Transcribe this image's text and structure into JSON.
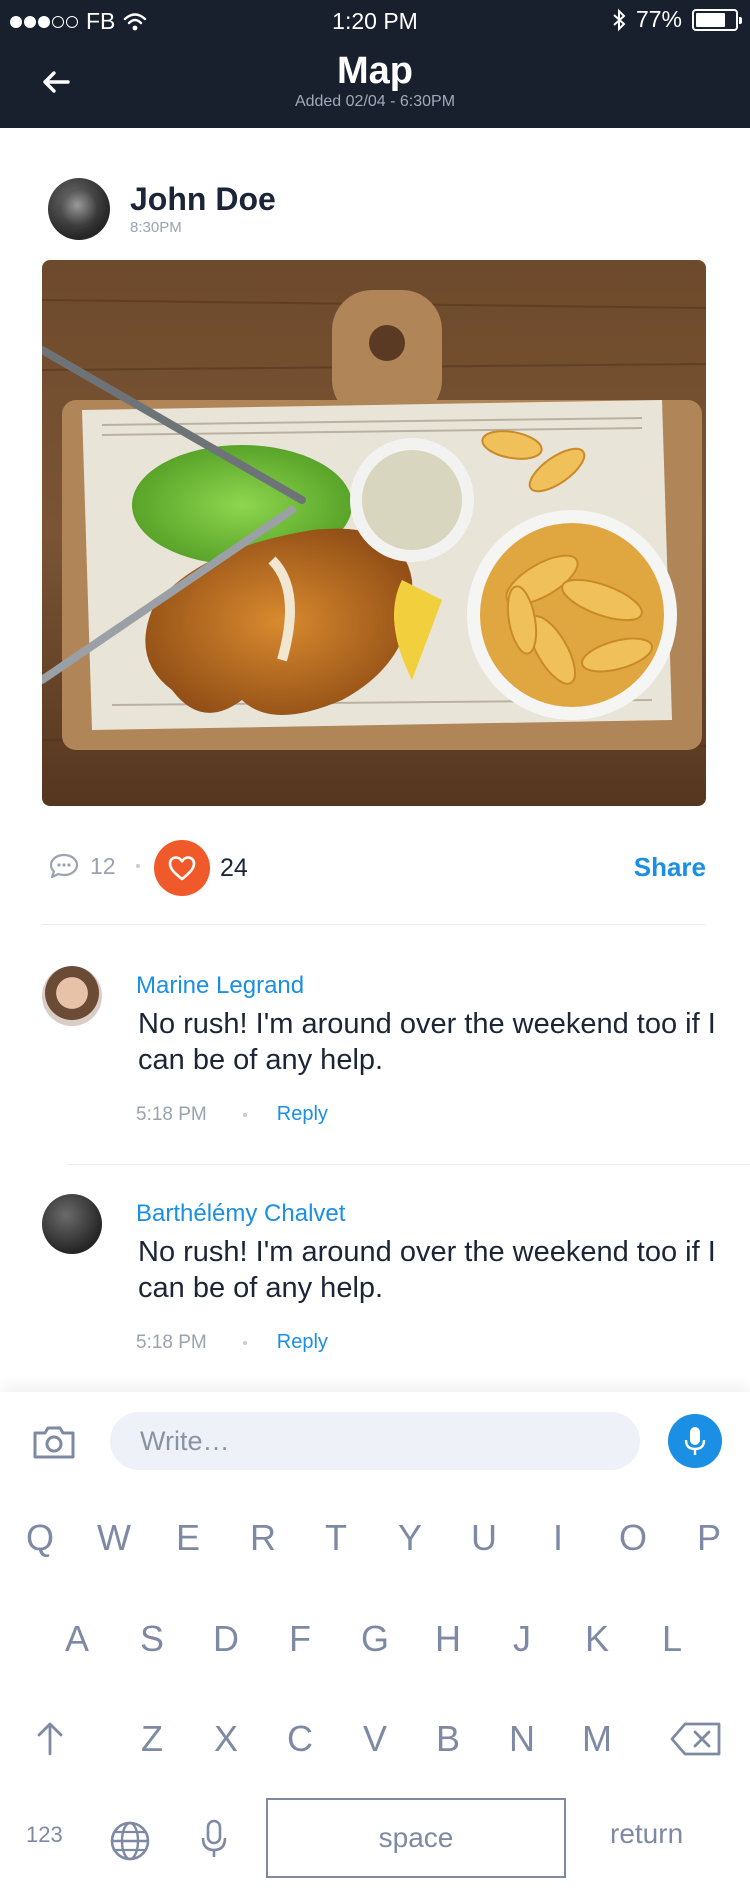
{
  "status_bar": {
    "carrier": "FB",
    "time": "1:20 PM",
    "battery": "77%",
    "signal_bars_filled": 3,
    "signal_bars_total": 5
  },
  "header": {
    "title": "Map",
    "subtitle": "Added 02/04 - 6:30PM",
    "back_icon": "arrow-left-icon"
  },
  "post": {
    "author_name": "John Doe",
    "author_time": "8:30PM",
    "image_alt": "fish and chips on wooden board",
    "comment_count": "12",
    "like_count": "24",
    "share_label": "Share"
  },
  "comments": [
    {
      "name": "Marine Legrand",
      "text": "No rush! I'm around over the weekend too if I can be of any help.",
      "time": "5:18 PM",
      "reply_label": "Reply"
    },
    {
      "name": "Barthélémy Chalvet",
      "text": "No rush! I'm around over the weekend too if I can be of any help.",
      "time": "5:18 PM",
      "reply_label": "Reply"
    }
  ],
  "composer": {
    "placeholder": "Write…",
    "camera_icon": "camera-icon",
    "mic_icon": "microphone-icon"
  },
  "keyboard": {
    "row1": [
      "Q",
      "W",
      "E",
      "R",
      "T",
      "Y",
      "U",
      "I",
      "O",
      "P"
    ],
    "row2": [
      "A",
      "S",
      "D",
      "F",
      "G",
      "H",
      "J",
      "K",
      "L"
    ],
    "row3": [
      "Z",
      "X",
      "C",
      "V",
      "B",
      "N",
      "M"
    ],
    "numbers_label": "123",
    "space_label": "space",
    "return_label": "return"
  },
  "colors": {
    "header_bg": "#18202e",
    "accent": "#1a8fe3",
    "like": "#f05a2b"
  }
}
